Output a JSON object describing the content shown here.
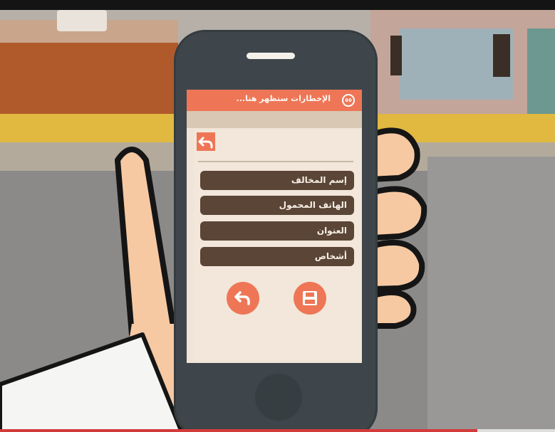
{
  "notification": {
    "text": "الإخطارات ستظهر هنا...",
    "badge": "٥٥"
  },
  "form": {
    "fields": [
      {
        "label": "إسم المخالف"
      },
      {
        "label": "الهاتف المحمول"
      },
      {
        "label": "العنوان"
      },
      {
        "label": "أشخاص"
      }
    ]
  },
  "icons": {
    "top_back": "undo-arrow-icon",
    "bottom_back": "undo-arrow-icon",
    "save": "floppy-disk-save-icon"
  },
  "video": {
    "progress_fraction": 0.86
  },
  "colors": {
    "accent": "#ee7656",
    "field_bg": "#5a4536",
    "screen_bg": "#f0e5d8",
    "phone_body": "#3e464b"
  }
}
